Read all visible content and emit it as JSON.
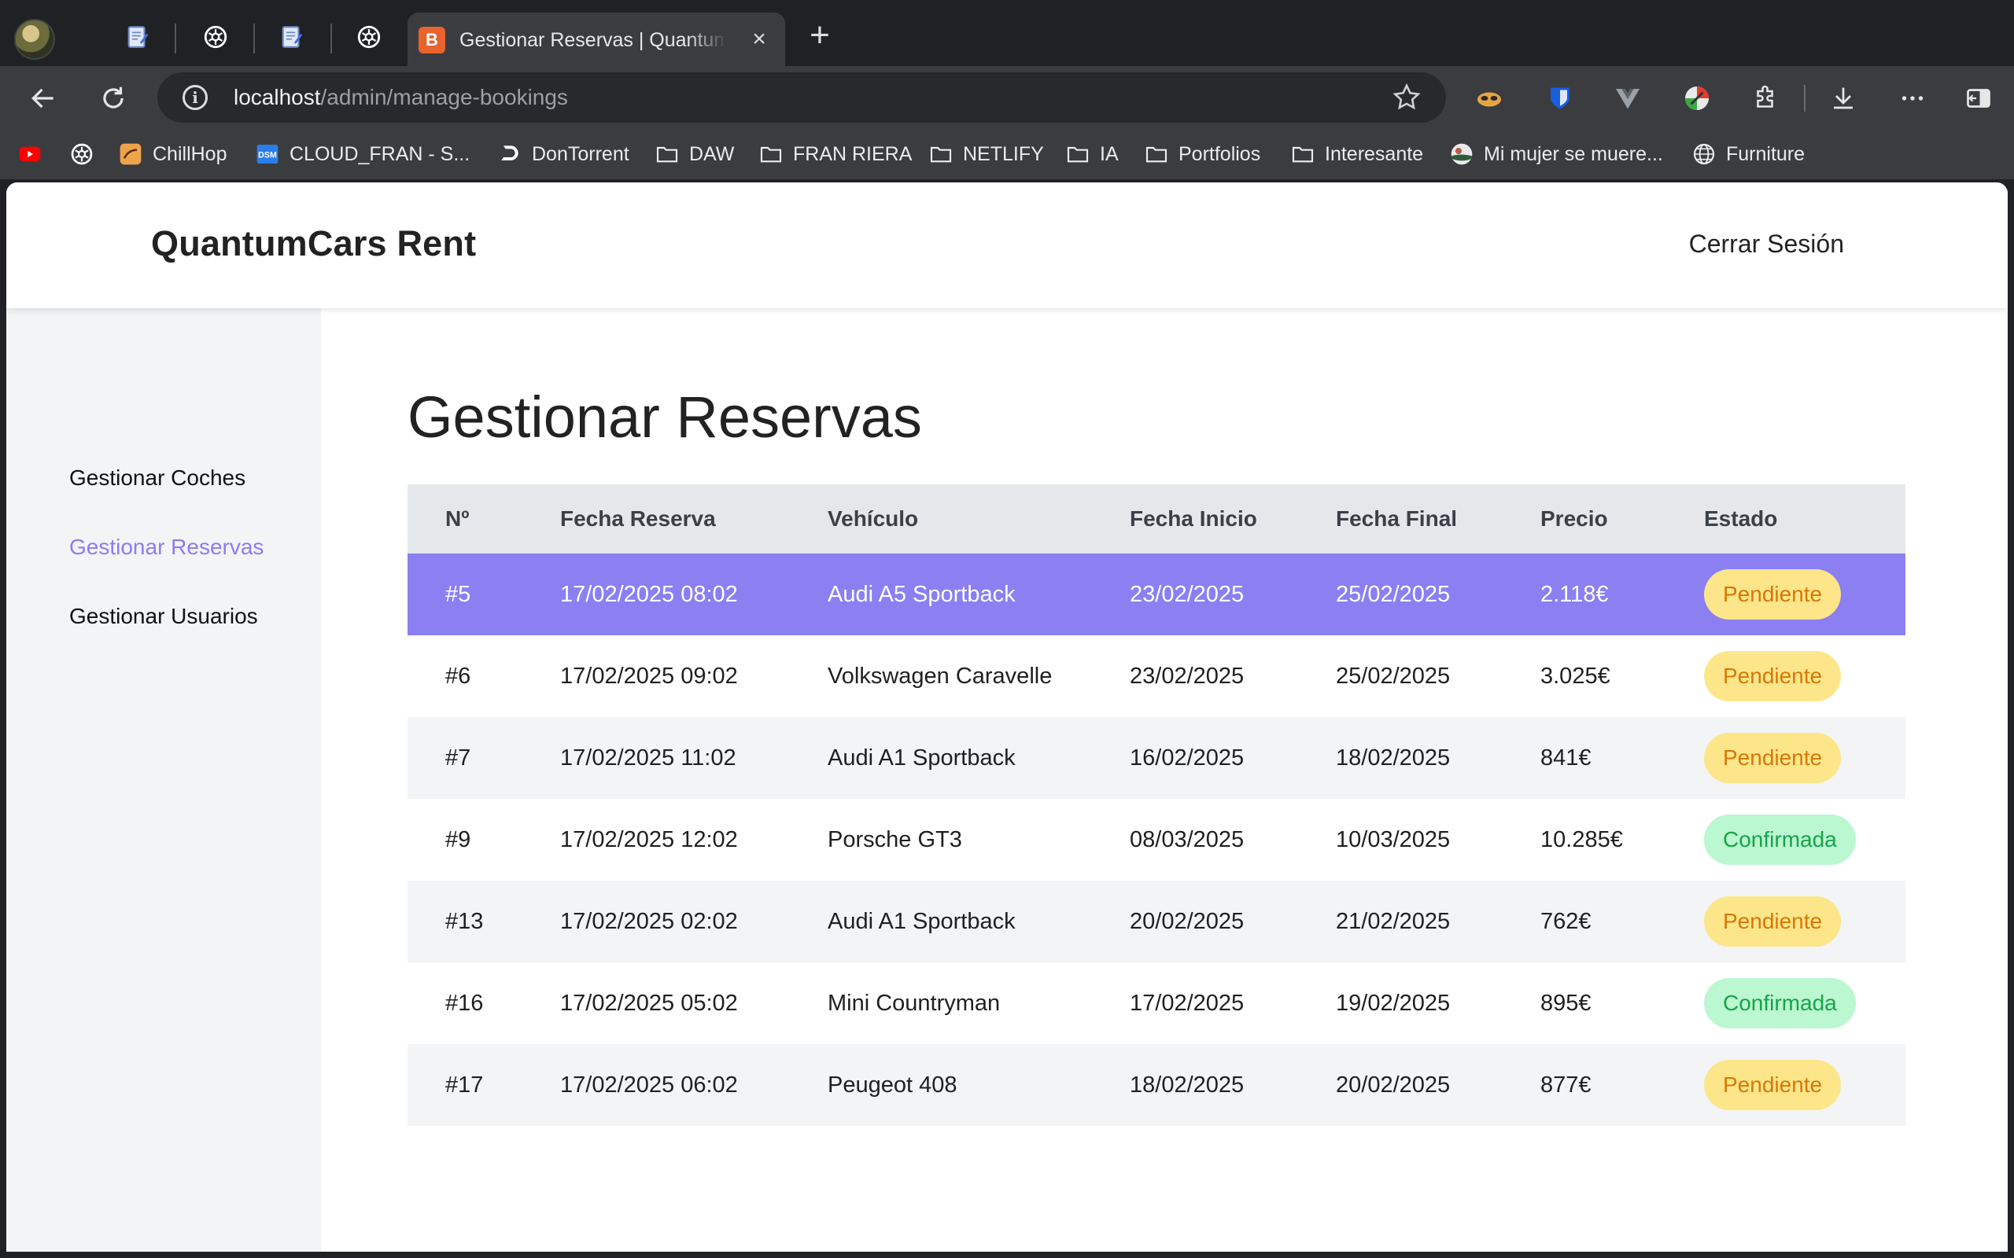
{
  "browser": {
    "active_tab": {
      "title": "Gestionar Reservas | QuantumCars Rent",
      "favicon_letter": "B"
    },
    "address": {
      "host": "localhost",
      "path": "/admin/manage-bookings"
    },
    "bookmarks": [
      {
        "label": "",
        "icon": "youtube-icon"
      },
      {
        "label": "",
        "icon": "openai-icon"
      },
      {
        "label": "ChillHop",
        "icon": "chillhop-icon"
      },
      {
        "label": "CLOUD_FRAN - S...",
        "icon": "dsm-icon"
      },
      {
        "label": "DonTorrent",
        "icon": "dontorrent-icon"
      },
      {
        "label": "DAW",
        "icon": "folder-icon"
      },
      {
        "label": "FRAN RIERA",
        "icon": "folder-icon"
      },
      {
        "label": "NETLIFY",
        "icon": "folder-icon"
      },
      {
        "label": "IA",
        "icon": "folder-icon"
      },
      {
        "label": "Portfolios",
        "icon": "folder-icon"
      },
      {
        "label": "Interesante",
        "icon": "folder-icon"
      },
      {
        "label": "Mi mujer se muere...",
        "icon": "site-icon"
      },
      {
        "label": "Furniture",
        "icon": "globe-icon"
      }
    ]
  },
  "site": {
    "brand": "QuantumCars Rent",
    "logout_label": "Cerrar Sesión"
  },
  "sidebar": {
    "items": [
      {
        "label": "Gestionar Coches",
        "active": false
      },
      {
        "label": "Gestionar Reservas",
        "active": true
      },
      {
        "label": "Gestionar Usuarios",
        "active": false
      }
    ]
  },
  "main": {
    "title": "Gestionar Reservas",
    "columns": [
      "Nº",
      "Fecha Reserva",
      "Vehículo",
      "Fecha Inicio",
      "Fecha Final",
      "Precio",
      "Estado"
    ],
    "rows": [
      {
        "id": "#5",
        "booked": "17/02/2025 08:02",
        "vehicle": "Audi A5 Sportback",
        "start": "23/02/2025",
        "end": "25/02/2025",
        "price": "2.118€",
        "status": "Pendiente"
      },
      {
        "id": "#6",
        "booked": "17/02/2025 09:02",
        "vehicle": "Volkswagen Caravelle",
        "start": "23/02/2025",
        "end": "25/02/2025",
        "price": "3.025€",
        "status": "Pendiente"
      },
      {
        "id": "#7",
        "booked": "17/02/2025 11:02",
        "vehicle": "Audi A1 Sportback",
        "start": "16/02/2025",
        "end": "18/02/2025",
        "price": "841€",
        "status": "Pendiente"
      },
      {
        "id": "#9",
        "booked": "17/02/2025 12:02",
        "vehicle": "Porsche GT3",
        "start": "08/03/2025",
        "end": "10/03/2025",
        "price": "10.285€",
        "status": "Confirmada"
      },
      {
        "id": "#13",
        "booked": "17/02/2025 02:02",
        "vehicle": "Audi A1 Sportback",
        "start": "20/02/2025",
        "end": "21/02/2025",
        "price": "762€",
        "status": "Pendiente"
      },
      {
        "id": "#16",
        "booked": "17/02/2025 05:02",
        "vehicle": "Mini Countryman",
        "start": "17/02/2025",
        "end": "19/02/2025",
        "price": "895€",
        "status": "Confirmada"
      },
      {
        "id": "#17",
        "booked": "17/02/2025 06:02",
        "vehicle": "Peugeot 408",
        "start": "18/02/2025",
        "end": "20/02/2025",
        "price": "877€",
        "status": "Pendiente"
      }
    ],
    "selected_row": "#5"
  },
  "colors": {
    "accent": "#8b7cf6",
    "selected_row": "#8b7ff2",
    "pending_bg": "#fde68a",
    "pending_text": "#d97706",
    "confirmed_bg": "#bbf7d0",
    "confirmed_text": "#16a34a"
  }
}
